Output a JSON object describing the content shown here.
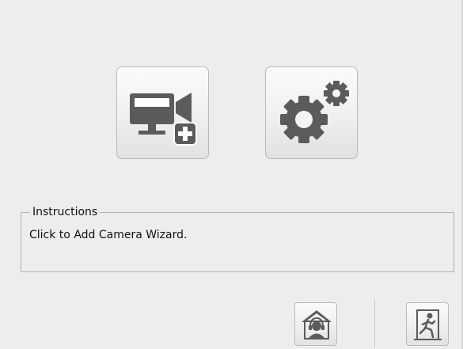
{
  "toolbar": {
    "add_camera": {
      "icon": "monitor-camera-add-icon",
      "title": "Add Camera Wizard"
    },
    "settings": {
      "icon": "gears-icon"
    }
  },
  "instructions": {
    "legend": "Instructions",
    "text": "Click to Add Camera Wizard."
  },
  "footer": {
    "support": {
      "icon": "support-agent-icon"
    },
    "exit": {
      "icon": "exit-door-icon"
    }
  },
  "colors": {
    "icon_gray": "#5b5b5b",
    "background": "#ededed",
    "border": "#b3b3b3"
  }
}
